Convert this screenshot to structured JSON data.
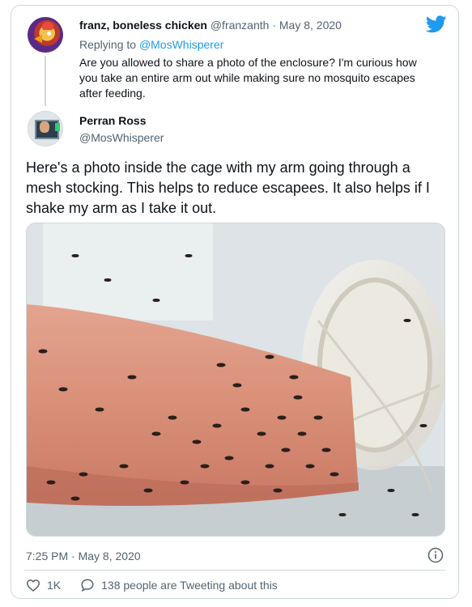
{
  "reply": {
    "name": "franz, boneless chicken",
    "handle": "@franzanth",
    "separator": "·",
    "date": "May 8, 2020",
    "replying_prefix": "Replying to",
    "replying_to": "@MosWhisperer",
    "text": "Are you allowed to share a photo of the enclosure? I'm curious how you take an entire arm out while making sure no mosquito escapes after feeding."
  },
  "tweet": {
    "name": "Perran Ross",
    "handle": "@MosWhisperer",
    "text": "Here's a photo inside the cage with my arm going through a mesh stocking. This helps to reduce escapees. It also helps if I shake my arm as I take it out.",
    "time": "7:25 PM",
    "separator": "·",
    "date": "May 8, 2020",
    "likes": "1K",
    "conversation": "138 people are Tweeting about this"
  },
  "icons": {
    "brand": "twitter-bird-icon",
    "info": "info-icon",
    "like": "heart-icon",
    "reply": "speech-bubble-icon"
  },
  "colors": {
    "twitter_blue": "#1d9bf0",
    "muted_text": "#536471",
    "border": "#cfd9de"
  }
}
